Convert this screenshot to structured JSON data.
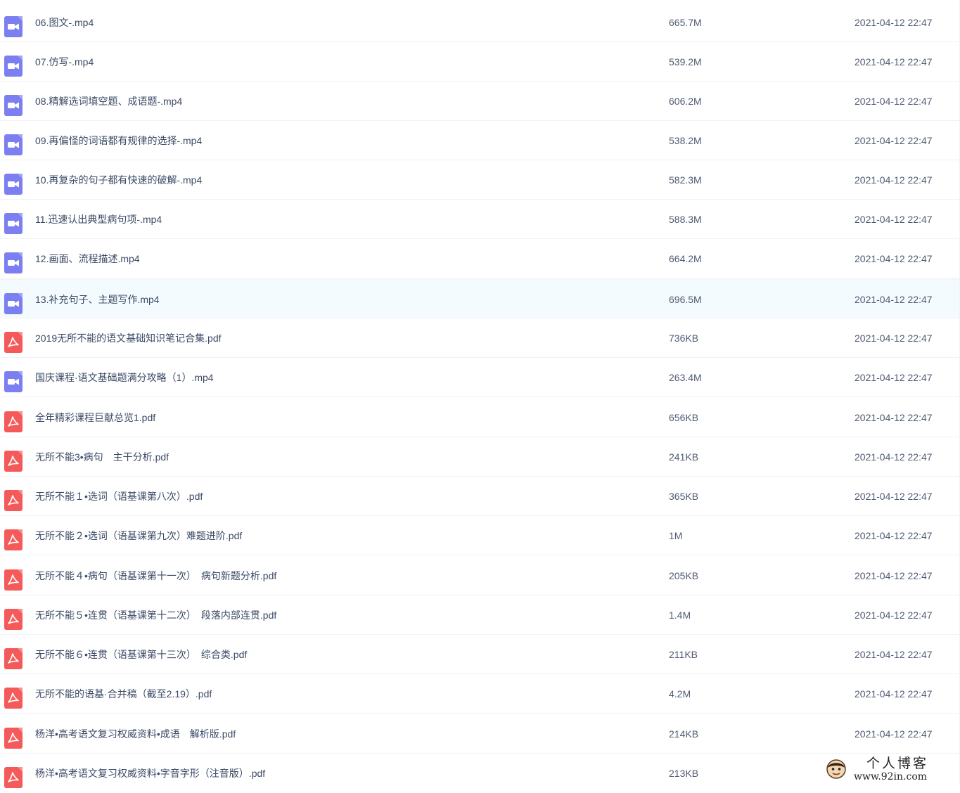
{
  "files": [
    {
      "name": "06.图文-.mp4",
      "size": "665.7M",
      "time": "2021-04-12 22:47",
      "type": "video",
      "icon": "video-file-icon"
    },
    {
      "name": "07.仿写-.mp4",
      "size": "539.2M",
      "time": "2021-04-12 22:47",
      "type": "video",
      "icon": "video-file-icon"
    },
    {
      "name": "08.精解选词填空题、成语题-.mp4",
      "size": "606.2M",
      "time": "2021-04-12 22:47",
      "type": "video",
      "icon": "video-file-icon"
    },
    {
      "name": "09.再偏怪的词语都有规律的选择-.mp4",
      "size": "538.2M",
      "time": "2021-04-12 22:47",
      "type": "video",
      "icon": "video-file-icon"
    },
    {
      "name": "10.再复杂的句子都有快速的破解-.mp4",
      "size": "582.3M",
      "time": "2021-04-12 22:47",
      "type": "video",
      "icon": "video-file-icon"
    },
    {
      "name": "11.迅速认出典型病句项-.mp4",
      "size": "588.3M",
      "time": "2021-04-12 22:47",
      "type": "video",
      "icon": "video-file-icon"
    },
    {
      "name": "12.画面、流程描述.mp4",
      "size": "664.2M",
      "time": "2021-04-12 22:47",
      "type": "video",
      "icon": "video-file-icon"
    },
    {
      "name": "13.补充句子、主题写作.mp4",
      "size": "696.5M",
      "time": "2021-04-12 22:47",
      "type": "video",
      "icon": "video-file-icon",
      "hovered": true
    },
    {
      "name": "2019无所不能的语文基础知识笔记合集.pdf",
      "size": "736KB",
      "time": "2021-04-12 22:47",
      "type": "pdf",
      "icon": "pdf-file-icon"
    },
    {
      "name": "国庆课程·语文基础题满分攻略（1）.mp4",
      "size": "263.4M",
      "time": "2021-04-12 22:47",
      "type": "video",
      "icon": "video-file-icon"
    },
    {
      "name": "全年精彩课程巨献总览1.pdf",
      "size": "656KB",
      "time": "2021-04-12 22:47",
      "type": "pdf",
      "icon": "pdf-file-icon"
    },
    {
      "name": "无所不能3•病句　主干分析.pdf",
      "size": "241KB",
      "time": "2021-04-12 22:47",
      "type": "pdf",
      "icon": "pdf-file-icon"
    },
    {
      "name": "无所不能１•选词（语基课第八次）.pdf",
      "size": "365KB",
      "time": "2021-04-12 22:47",
      "type": "pdf",
      "icon": "pdf-file-icon"
    },
    {
      "name": "无所不能２•选词（语基课第九次）难题进阶.pdf",
      "size": "1M",
      "time": "2021-04-12 22:47",
      "type": "pdf",
      "icon": "pdf-file-icon"
    },
    {
      "name": "无所不能４•病句（语基课第十一次）　病句新题分析.pdf",
      "size": "205KB",
      "time": "2021-04-12 22:47",
      "type": "pdf",
      "icon": "pdf-file-icon"
    },
    {
      "name": "无所不能５•连贯（语基课第十二次）　段落内部连贯.pdf",
      "size": "1.4M",
      "time": "2021-04-12 22:47",
      "type": "pdf",
      "icon": "pdf-file-icon"
    },
    {
      "name": "无所不能６•连贯（语基课第十三次）　综合类.pdf",
      "size": "211KB",
      "time": "2021-04-12 22:47",
      "type": "pdf",
      "icon": "pdf-file-icon"
    },
    {
      "name": "无所不能的语基·合并稿（截至2.19）.pdf",
      "size": "4.2M",
      "time": "2021-04-12 22:47",
      "type": "pdf",
      "icon": "pdf-file-icon"
    },
    {
      "name": "杨洋•高考语文复习权威资料•成语　解析版.pdf",
      "size": "214KB",
      "time": "2021-04-12 22:47",
      "type": "pdf",
      "icon": "pdf-file-icon"
    },
    {
      "name": "杨洋•高考语文复习权威资料•字音字形（注音版）.pdf",
      "size": "213KB",
      "time": "",
      "type": "pdf",
      "icon": "pdf-file-icon"
    }
  ],
  "watermark": {
    "title": "个人博客",
    "url": "www.92in.com",
    "icon": "avatar-icon"
  },
  "colors": {
    "video_icon": "#7b7ff0",
    "pdf_icon": "#f55a5a",
    "hover_row": "#f4fbff",
    "divider": "#f1f2f5"
  }
}
